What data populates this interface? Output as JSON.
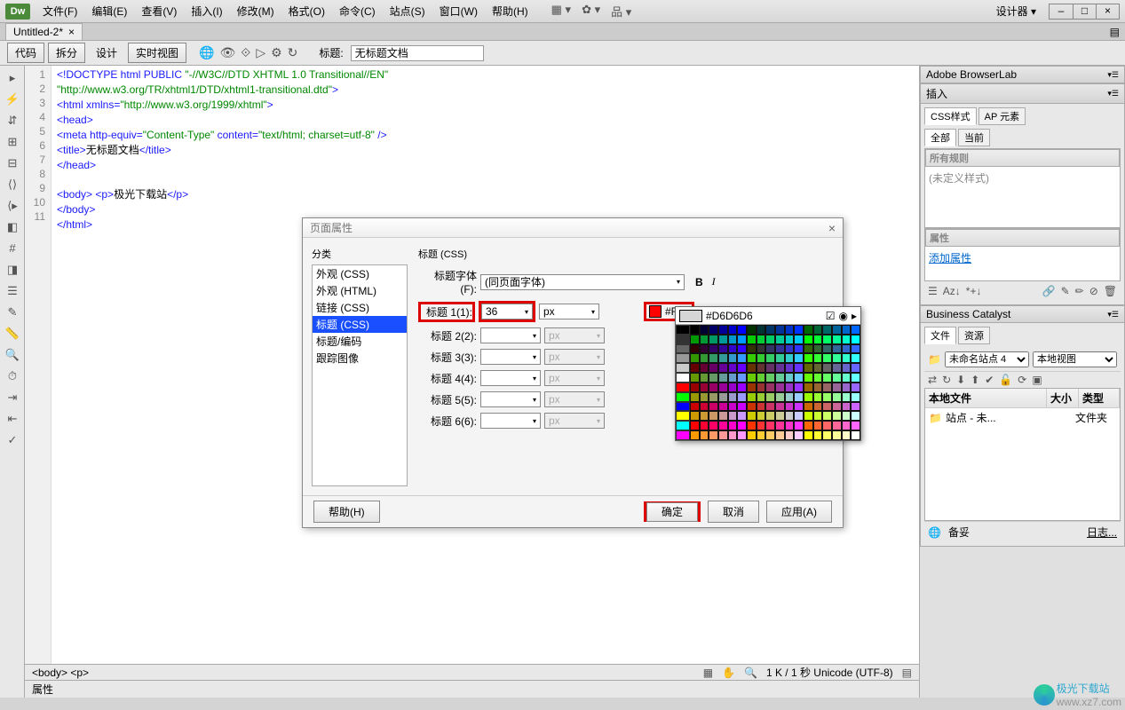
{
  "app": {
    "logo": "Dw",
    "designer": "设计器",
    "win_min": "–",
    "win_max": "□",
    "win_close": "×"
  },
  "menu": {
    "file": "文件(F)",
    "edit": "编辑(E)",
    "view": "查看(V)",
    "insert": "插入(I)",
    "modify": "修改(M)",
    "format": "格式(O)",
    "command": "命令(C)",
    "site": "站点(S)",
    "window": "窗口(W)",
    "help": "帮助(H)"
  },
  "doc_tab": {
    "name": "Untitled-2*",
    "close": "×"
  },
  "toolbar": {
    "code": "代码",
    "split": "拆分",
    "design": "设计",
    "live": "实时视图",
    "title_label": "标题:",
    "title_value": "无标题文档"
  },
  "code": {
    "l1a": "<!DOCTYPE html PUBLIC ",
    "l1b": "\"-//W3C//DTD XHTML 1.0 Transitional//EN\"",
    "l1c": "\"http://www.w3.org/TR/xhtml1/DTD/xhtml1-transitional.dtd\"",
    "l2a": "<html xmlns=",
    "l2b": "\"http://www.w3.org/1999/xhtml\"",
    "l3": "<head>",
    "l4a": "<meta http-equiv=",
    "l4b": "\"Content-Type\"",
    "l4c": " content=",
    "l4d": "\"text/html; charset=utf-8\"",
    "l4e": " />",
    "l5a": "<title>",
    "l5b": "无标题文档",
    "l5c": "</title>",
    "l6": "</head>",
    "l8a": "<body> <p>",
    "l8b": "极光下载站",
    "l8c": "</p>",
    "l9": "</body>",
    "l10": "</html>",
    "line_numbers": [
      "1",
      "2",
      "3",
      "4",
      "5",
      "6",
      "7",
      "8",
      "9",
      "10",
      "11"
    ]
  },
  "status": {
    "path": "<body> <p>",
    "size": "1 K / 1 秒 Unicode (UTF-8)"
  },
  "props_bar": {
    "label": "属性"
  },
  "right": {
    "browserlab": "Adobe BrowserLab",
    "insert": "插入",
    "css_styles": "CSS样式",
    "ap_elements": "AP 元素",
    "all": "全部",
    "current": "当前",
    "all_rules": "所有规则",
    "no_styles": "(未定义样式)",
    "properties": "属性",
    "add_property": "添加属性",
    "business_catalyst": "Business Catalyst",
    "files_tab": "文件",
    "resources_tab": "资源",
    "site_dropdown": "未命名站点 4",
    "view_dropdown": "本地视图",
    "local_files": "本地文件",
    "size_col": "大小",
    "type_col": "类型",
    "site_row_name": "站点 - 未...",
    "site_row_type": "文件夹",
    "ready": "备妥",
    "log": "日志..."
  },
  "dialog": {
    "title": "页面属性",
    "close": "×",
    "category_label": "分类",
    "section_title": "标题 (CSS)",
    "categories": [
      "外观 (CSS)",
      "外观 (HTML)",
      "链接 (CSS)",
      "标题 (CSS)",
      "标题/编码",
      "跟踪图像"
    ],
    "font_label": "标题字体(F):",
    "font_value": "(同页面字体)",
    "h1_label": "标题 1(1):",
    "h1_size": "36",
    "h1_color": "#F00",
    "h2_label": "标题 2(2):",
    "h3_label": "标题 3(3):",
    "h4_label": "标题 4(4):",
    "h5_label": "标题 5(5):",
    "h6_label": "标题 6(6):",
    "unit": "px",
    "help": "帮助(H)",
    "ok": "确定",
    "cancel": "取消",
    "apply": "应用(A)"
  },
  "color_popup": {
    "hex": "#D6D6D6"
  },
  "watermark": {
    "line1": "极光下载站",
    "line2": "www.xz7.com"
  }
}
